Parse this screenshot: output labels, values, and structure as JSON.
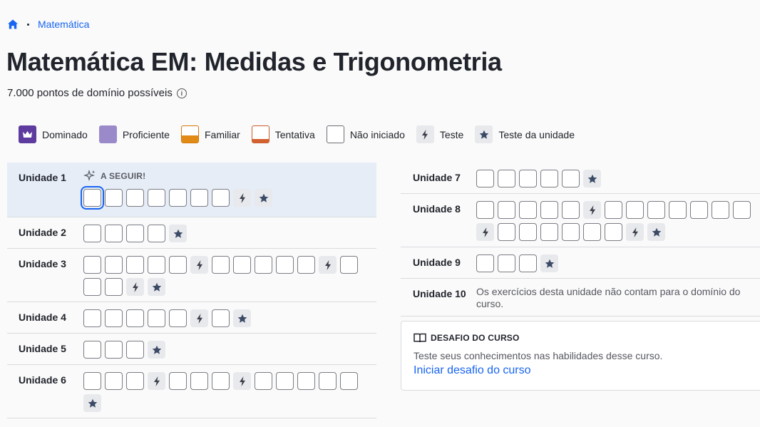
{
  "breadcrumb": {
    "link": "Matemática"
  },
  "page": {
    "title": "Matemática EM: Medidas e Trigonometria",
    "subtitle": "7.000 pontos de domínio possíveis"
  },
  "legend": [
    {
      "label": "Dominado",
      "kind": "mastered"
    },
    {
      "label": "Proficiente",
      "kind": "proficient"
    },
    {
      "label": "Familiar",
      "kind": "familiar"
    },
    {
      "label": "Tentativa",
      "kind": "attempted"
    },
    {
      "label": "Não iniciado",
      "kind": "not-started"
    },
    {
      "label": "Teste",
      "kind": "quiz"
    },
    {
      "label": "Teste da unidade",
      "kind": "unit-test"
    }
  ],
  "next_label": "A SEGUIR!",
  "units_left": [
    {
      "name": "Unidade 1",
      "next": true,
      "items": [
        "c",
        "e",
        "e",
        "e",
        "e",
        "e",
        "e",
        "q",
        "t"
      ]
    },
    {
      "name": "Unidade 2",
      "items": [
        "e",
        "e",
        "e",
        "e",
        "t"
      ]
    },
    {
      "name": "Unidade 3",
      "items": [
        "e",
        "e",
        "e",
        "e",
        "e",
        "q",
        "e",
        "e",
        "e",
        "e",
        "e",
        "q",
        "e",
        "e",
        "e",
        "q",
        "t"
      ]
    },
    {
      "name": "Unidade 4",
      "items": [
        "e",
        "e",
        "e",
        "e",
        "e",
        "q",
        "e",
        "t"
      ]
    },
    {
      "name": "Unidade 5",
      "items": [
        "e",
        "e",
        "e",
        "t"
      ]
    },
    {
      "name": "Unidade 6",
      "items": [
        "e",
        "e",
        "e",
        "q",
        "e",
        "e",
        "e",
        "q",
        "e",
        "e",
        "e",
        "e",
        "e",
        "t"
      ]
    }
  ],
  "units_right": [
    {
      "name": "Unidade 7",
      "items": [
        "e",
        "e",
        "e",
        "e",
        "e",
        "t"
      ]
    },
    {
      "name": "Unidade 8",
      "items": [
        "e",
        "e",
        "e",
        "e",
        "e",
        "q",
        "e",
        "e",
        "e",
        "e",
        "e",
        "e",
        "e",
        "q",
        "e",
        "e",
        "e",
        "e",
        "e",
        "e",
        "q",
        "t"
      ]
    },
    {
      "name": "Unidade 9",
      "items": [
        "e",
        "e",
        "e",
        "t"
      ]
    },
    {
      "name": "Unidade 10",
      "note": "Os exercícios desta unidade não contam para o domínio do curso."
    }
  ],
  "challenge": {
    "title": "DESAFIO DO CURSO",
    "text": "Teste seus conhecimentos nas habilidades desse curso.",
    "link": "Iniciar desafio do curso"
  },
  "colors": {
    "accent": "#1865f2",
    "mastered": "#5e3b9e",
    "proficient": "#9b8ac9",
    "familiar": "#e28a16",
    "attempted": "#d3612f"
  }
}
